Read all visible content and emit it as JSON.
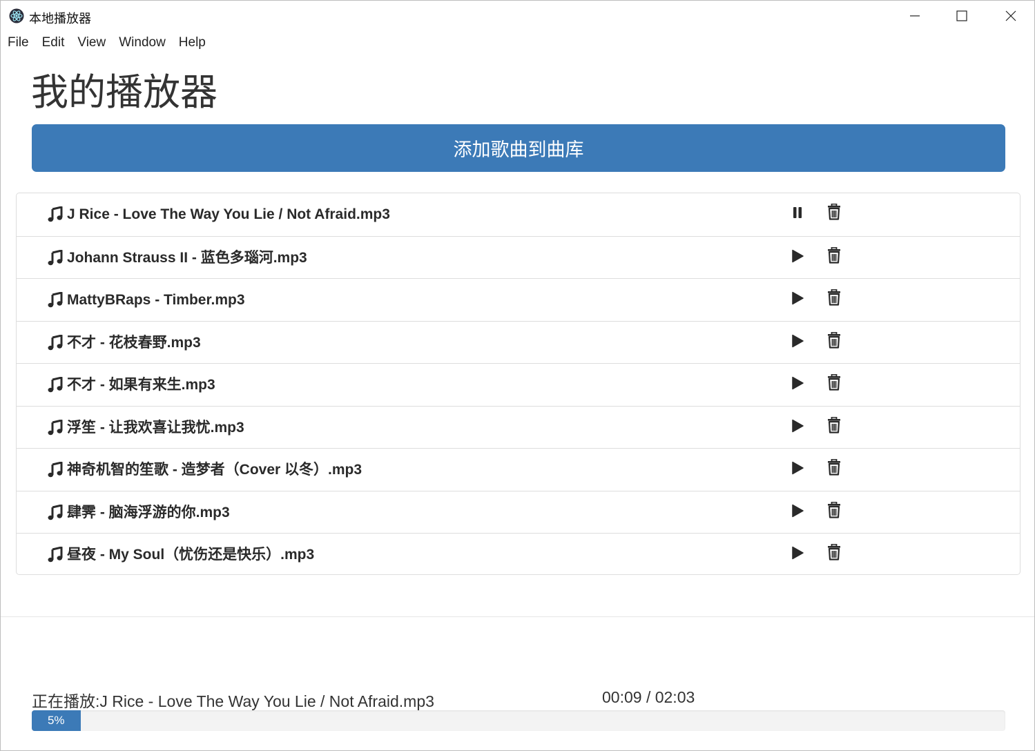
{
  "window": {
    "title": "本地播放器",
    "app_icon": "electron-icon",
    "controls": [
      "minimize-icon",
      "maximize-icon",
      "close-icon"
    ]
  },
  "menu": [
    "File",
    "Edit",
    "View",
    "Window",
    "Help"
  ],
  "page": {
    "title": "我的播放器",
    "add_button_label": "添加歌曲到曲库",
    "accent_color": "#3c7ab7"
  },
  "songs": [
    {
      "name": "J Rice - Love The Way You Lie / Not Afraid.mp3",
      "state": "playing",
      "action_icon": "pause-icon"
    },
    {
      "name": "Johann Strauss II - 蓝色多瑙河.mp3",
      "state": "stopped",
      "action_icon": "play-icon"
    },
    {
      "name": "MattyBRaps - Timber.mp3",
      "state": "stopped",
      "action_icon": "play-icon"
    },
    {
      "name": "不才 - 花枝春野.mp3",
      "state": "stopped",
      "action_icon": "play-icon"
    },
    {
      "name": "不才 - 如果有来生.mp3",
      "state": "stopped",
      "action_icon": "play-icon"
    },
    {
      "name": "浮笙 - 让我欢喜让我忧.mp3",
      "state": "stopped",
      "action_icon": "play-icon"
    },
    {
      "name": "神奇机智的笙歌 - 造梦者（Cover 以冬）.mp3",
      "state": "stopped",
      "action_icon": "play-icon"
    },
    {
      "name": "肆霁 - 脑海浮游的你.mp3",
      "state": "stopped",
      "action_icon": "play-icon"
    },
    {
      "name": "昼夜 - My Soul（忧伤还是快乐）.mp3",
      "state": "stopped",
      "action_icon": "play-icon"
    }
  ],
  "player": {
    "now_playing": "正在播放:J Rice - Love The Way You Lie / Not Afraid.mp3",
    "time": "00:09 / 02:03",
    "progress_label": "5%",
    "progress_fraction": 0.05
  }
}
